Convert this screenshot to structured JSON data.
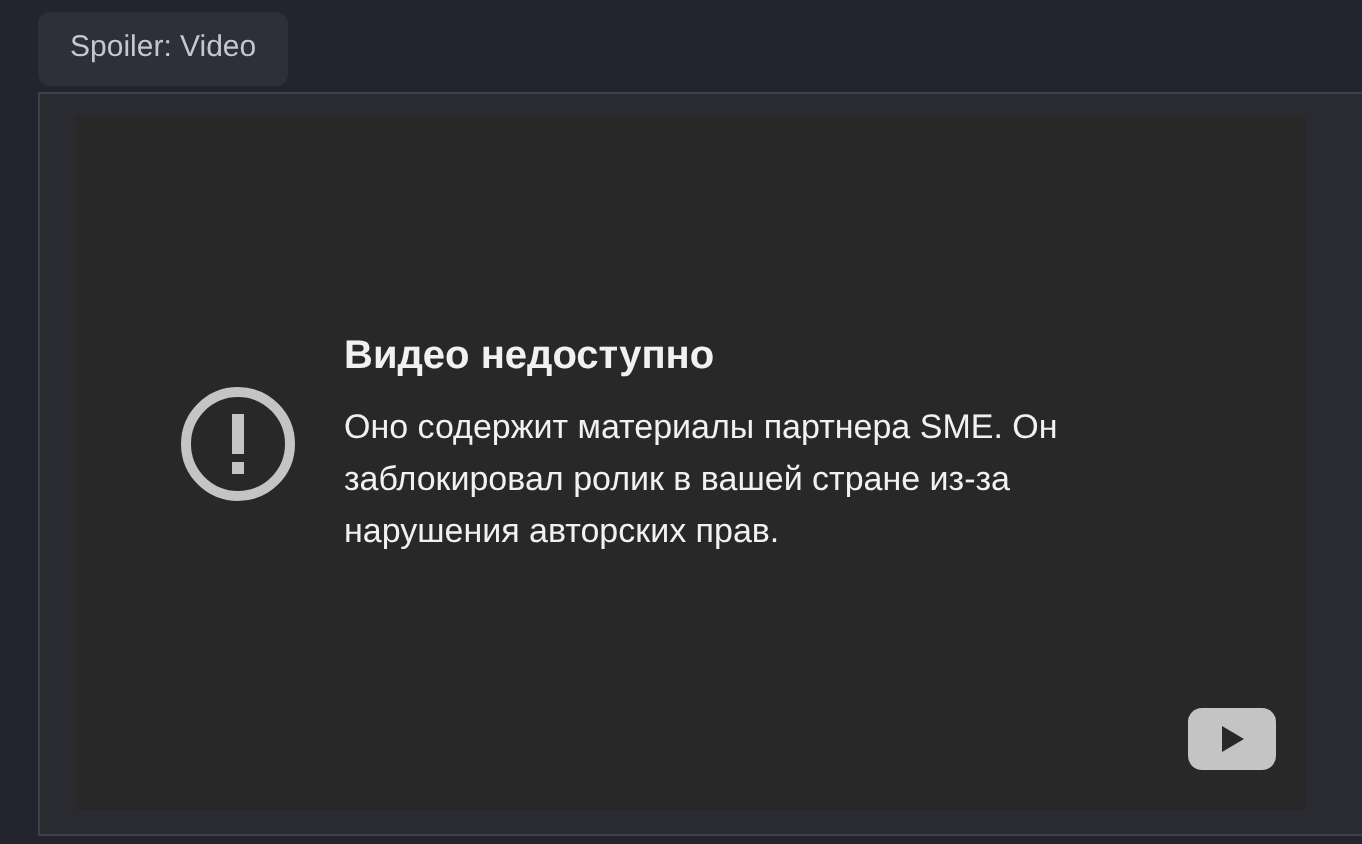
{
  "spoiler_button": {
    "label": "Spoiler: Video"
  },
  "video": {
    "title": "Видео недоступно",
    "message": "Оно содержит материалы партнера SME. Он заблокировал ролик в вашей стране из-за нарушения авторских прав."
  }
}
